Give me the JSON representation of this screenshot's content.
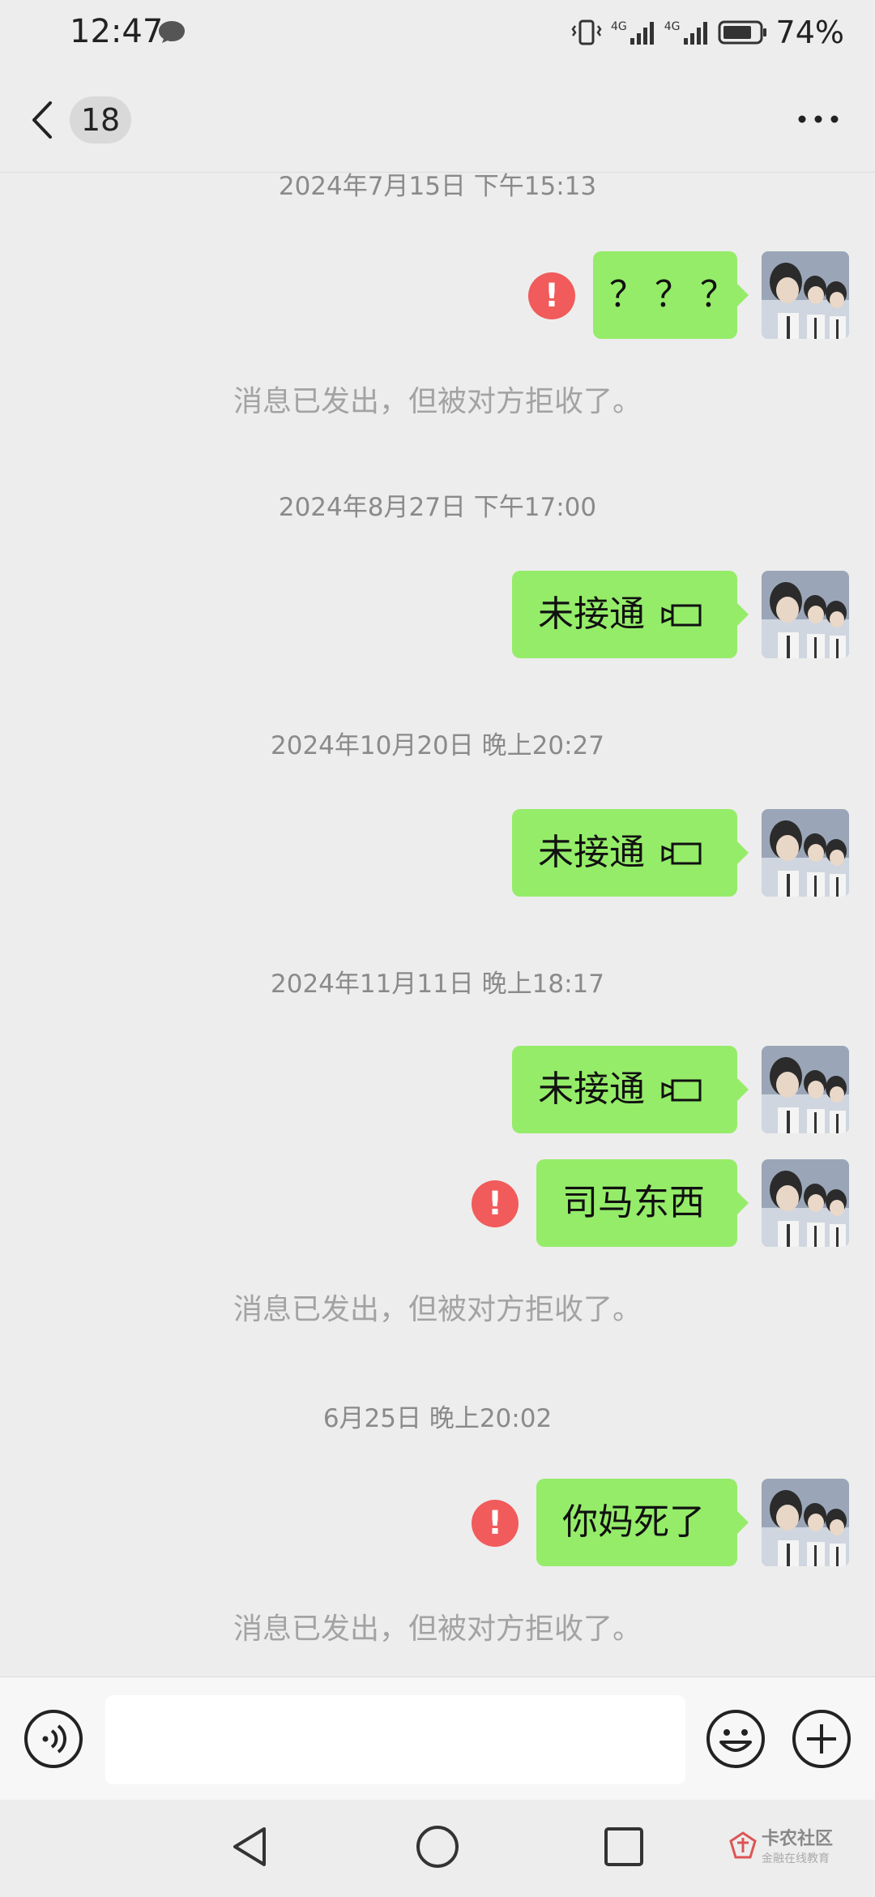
{
  "status_bar": {
    "time": "12:47",
    "network1": "4G",
    "network2": "4G",
    "battery": "74%"
  },
  "header": {
    "unread_count": "18"
  },
  "messages": [
    {
      "timestamp": "2024年7月15日 下午15:13",
      "text": "？？？",
      "failed": true,
      "system": "消息已发出，但被对方拒收了。"
    },
    {
      "timestamp": "2024年8月27日 下午17:00",
      "text": "未接通",
      "call": true
    },
    {
      "timestamp": "2024年10月20日 晚上20:27",
      "text": "未接通",
      "call": true
    },
    {
      "timestamp": "2024年11月11日 晚上18:17",
      "text": "未接通",
      "call": true
    },
    {
      "text": "司马东西",
      "failed": true,
      "system": "消息已发出，但被对方拒收了。"
    },
    {
      "timestamp": "6月25日 晚上20:02",
      "text": "你妈死了",
      "failed": true,
      "system": "消息已发出，但被对方拒收了。"
    }
  ],
  "watermark": {
    "title": "卡农社区",
    "subtitle": "金融在线教育"
  },
  "colors": {
    "bubble": "#95ec69",
    "error": "#f15b5b",
    "background": "#ededed"
  }
}
